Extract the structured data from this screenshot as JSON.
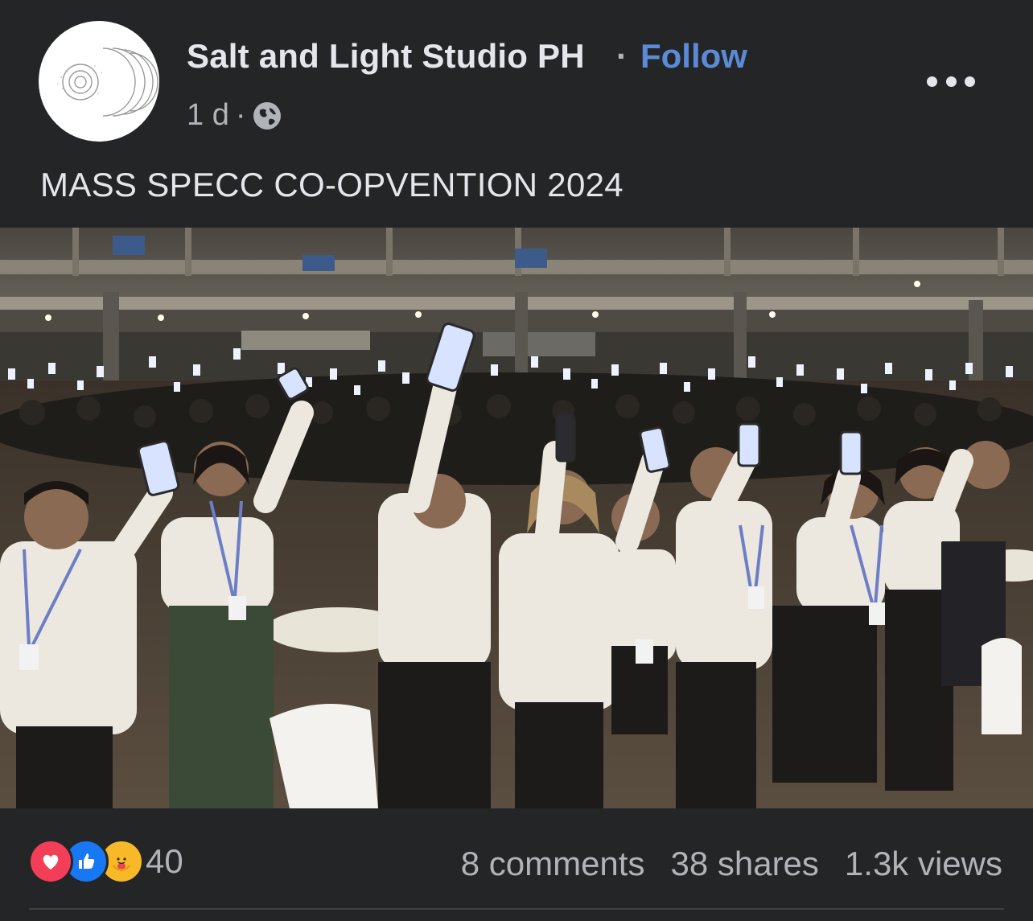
{
  "post": {
    "page_name": "Salt and Light Studio PH",
    "separator": "·",
    "follow_label": "Follow",
    "time_ago": "1 d",
    "meta_separator": "·",
    "audience_icon": "globe-icon",
    "more_icon": "more-horizontal-icon",
    "caption": "MASS SPECC CO-OPVENTION 2024"
  },
  "media": {
    "type": "photo",
    "overlay_icon": "picture-in-picture-icon"
  },
  "engagement": {
    "reaction_icons": [
      "love-reaction-icon",
      "like-reaction-icon",
      "care-reaction-icon"
    ],
    "reaction_count": "40",
    "comments": "8 comments",
    "shares": "38 shares",
    "views": "1.3k views"
  },
  "colors": {
    "background": "#242526",
    "text_primary": "#e4e6eb",
    "text_secondary": "#b0b3b8",
    "follow": "#5b8ad6",
    "love": "#f33e58",
    "like": "#1877f2",
    "care": "#f7b928"
  }
}
